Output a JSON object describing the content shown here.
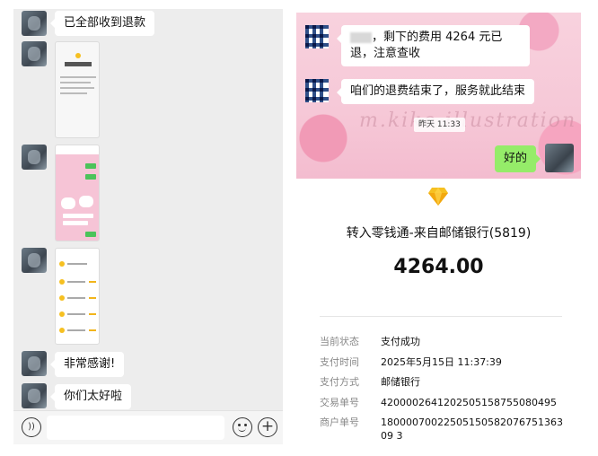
{
  "left_chat": {
    "messages": [
      {
        "type": "text",
        "text": "已全部收到退款"
      },
      {
        "type": "image",
        "desc": "screenshot-receipt"
      },
      {
        "type": "image",
        "desc": "screenshot-pink-chat"
      },
      {
        "type": "image",
        "desc": "screenshot-bill-list"
      },
      {
        "type": "text",
        "text": "非常感谢!"
      },
      {
        "type": "text",
        "text": "你们太好啦"
      }
    ],
    "receipt_thumb_amount": "4264.00",
    "input_bar": {
      "voice_icon": "voice-icon",
      "emoji_icon": "emoji-icon",
      "plus_icon": "plus-icon",
      "placeholder": ""
    }
  },
  "right_chat": {
    "messages": [
      {
        "prefix_blurred": true,
        "text": "，剩下的费用 4264 元已退，注意查收"
      },
      {
        "text": "咱们的退费结束了，服务就此结束"
      }
    ],
    "timestamp": "昨天 11:33",
    "reply": "好的",
    "background_script": "m.kiko illustration"
  },
  "payment": {
    "icon": "diamond-icon",
    "title": "转入零钱通-来自邮储银行(5819)",
    "amount": "4264.00",
    "details": [
      {
        "label": "当前状态",
        "value": "支付成功"
      },
      {
        "label": "支付时间",
        "value": "2025年5月15日 11:37:39"
      },
      {
        "label": "支付方式",
        "value": "邮储银行"
      },
      {
        "label": "交易单号",
        "value": "4200002641202505158755080495"
      },
      {
        "label": "商户单号",
        "value": "1800007002250515058207675136309 3"
      }
    ],
    "accent_color": "#f6c021"
  }
}
